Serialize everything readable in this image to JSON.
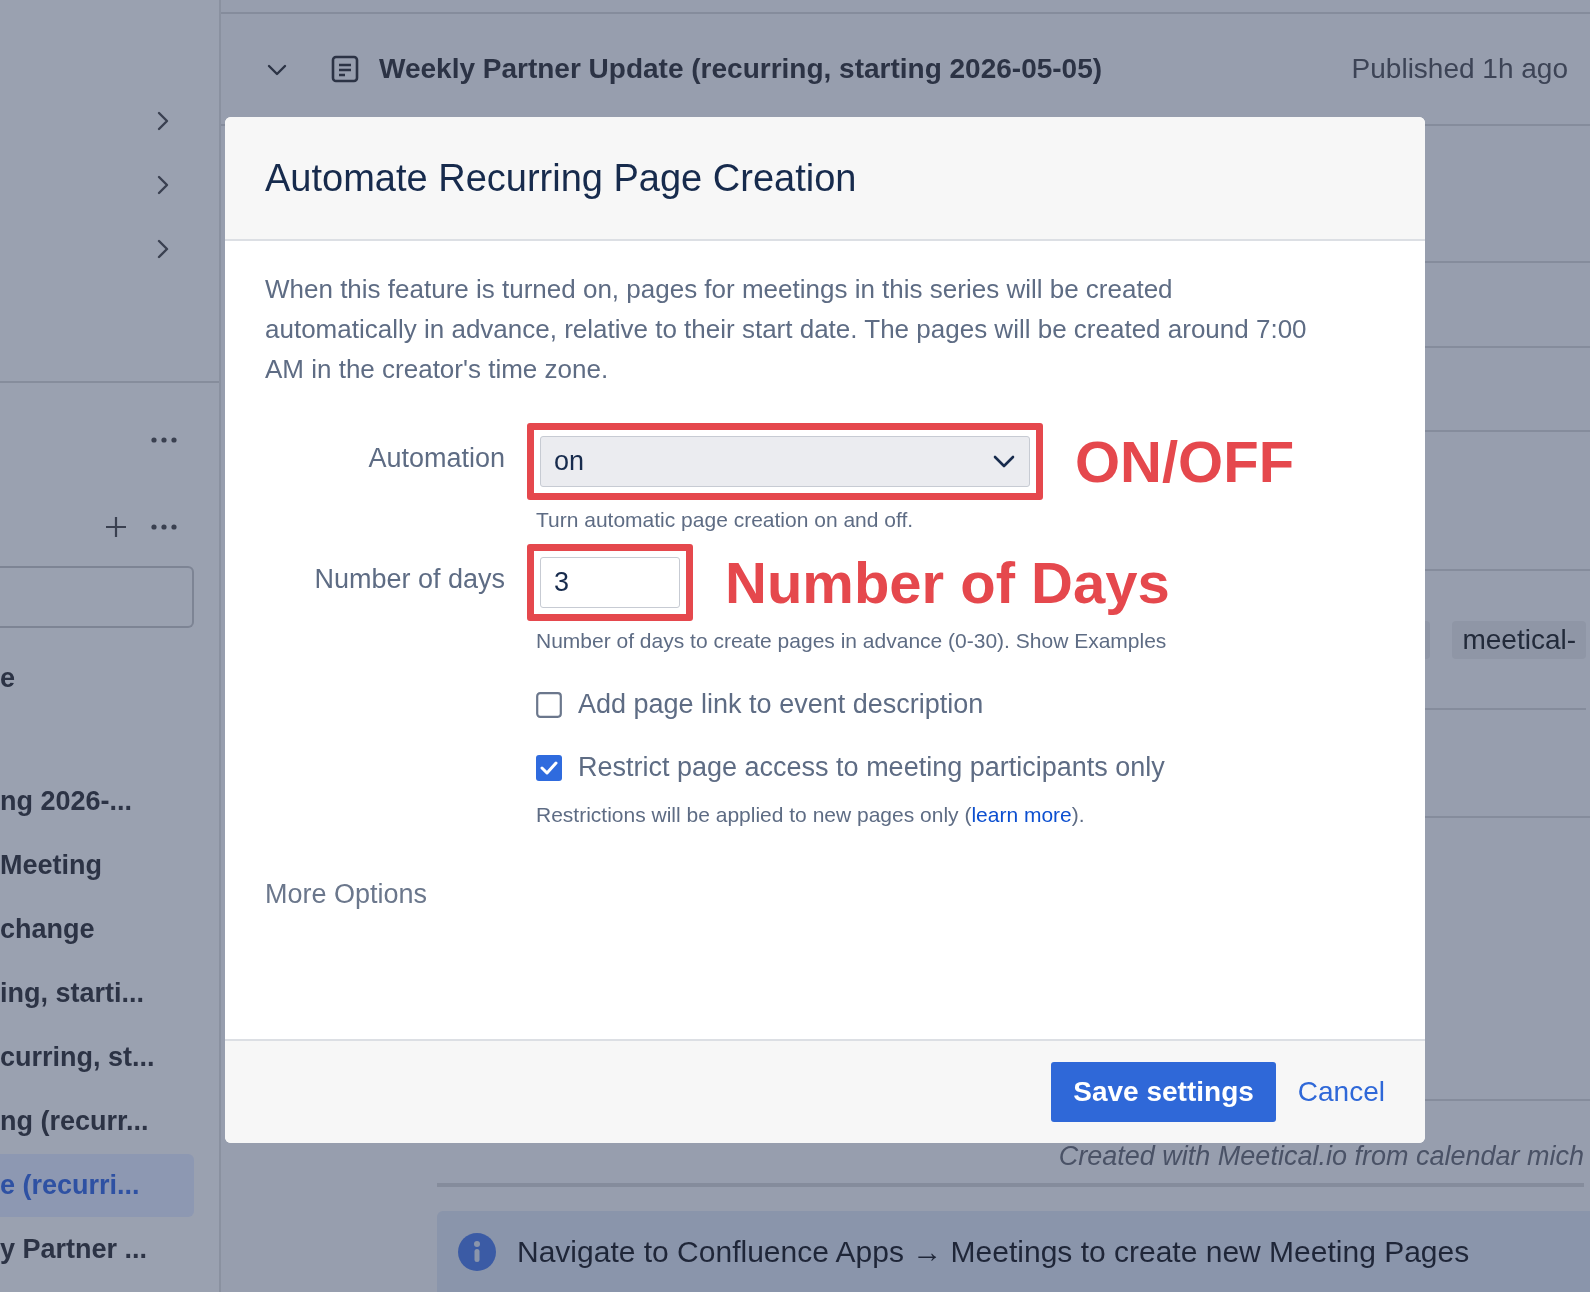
{
  "sidebar": {
    "nav_rows": [
      {
        "expanded": false
      },
      {
        "expanded": false
      },
      {
        "expanded": false
      }
    ],
    "section_label": "e",
    "pages": [
      {
        "title": "ng 2026-...",
        "selected": false
      },
      {
        "title": "Meeting",
        "selected": false
      },
      {
        "title": "change",
        "selected": false
      },
      {
        "title": "ing, starti...",
        "selected": false
      },
      {
        "title": "curring, st...",
        "selected": false
      },
      {
        "title": "ng (recurr...",
        "selected": false
      },
      {
        "title": "e (recurri...",
        "selected": true
      },
      {
        "title": "y Partner ...",
        "selected": false
      }
    ]
  },
  "page": {
    "header": {
      "expanded": true,
      "title": "Weekly Partner Update (recurring, starting 2026-05-05)",
      "status": "Published 1h ago"
    },
    "tags": [
      "meetical-"
    ],
    "footer_note": "Created with Meetical.io from calendar mich",
    "info_banner": "Navigate to Confluence Apps → Meetings to create new Meeting Pages"
  },
  "dialog": {
    "title": "Automate Recurring Page Creation",
    "description": "When this feature is turned on, pages for meetings in this series will be created automatically in advance, relative to their start date. The pages will be created around 7:00 AM in the creator's time zone.",
    "fields": [
      {
        "kind": "select",
        "label": "Automation",
        "value": "on",
        "help": "Turn automatic page creation on and off.",
        "annotation": "ON/OFF"
      },
      {
        "kind": "number",
        "label": "Number of days",
        "value": "3",
        "help": "Number of days to create pages in advance (0-30). Show Examples",
        "annotation": "Number of Days"
      }
    ],
    "checkboxes": [
      {
        "label": "Add page link to event description",
        "checked": false
      },
      {
        "label": "Restrict page access to meeting participants only",
        "checked": true,
        "note": "Restrictions will be applied to new pages only (",
        "note_link": "learn more",
        "note_end": ")."
      }
    ],
    "more_options": "More Options",
    "buttons": [
      {
        "kind": "primary",
        "label": "Save settings"
      },
      {
        "kind": "link",
        "label": "Cancel"
      }
    ]
  }
}
